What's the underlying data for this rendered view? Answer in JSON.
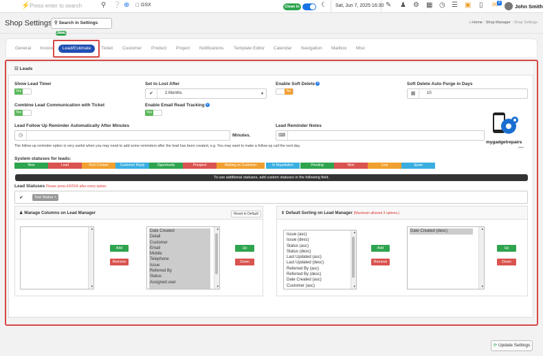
{
  "topbar": {
    "search_placeholder": "Press enter to search",
    "store": "GSX",
    "clock_in": "Clean In",
    "datetime": "Sat, Jun 7, 2025 16:30",
    "notif_count": "8",
    "user_name": "John Smith"
  },
  "header": {
    "title": "Shop Settings",
    "search_settings": "Search in Settings",
    "new_badge": "New",
    "breadcrumbs": [
      "Home",
      "Shop Manager",
      "Shop Settings"
    ]
  },
  "tabs": [
    "General",
    "Invoice",
    "Lead/Estimate",
    "Ticket",
    "Customer",
    "Product",
    "Project",
    "Notifications",
    "Template Editor",
    "Calendar",
    "Navigation",
    "Mailbox",
    "Misc"
  ],
  "active_tab": "Lead/Estimate",
  "leads": {
    "section_title": "Leads",
    "show_lead_timer": {
      "label": "Show Lead Timer",
      "value": "Yes"
    },
    "set_to_lost_after": {
      "label": "Set to Lost After",
      "value": "2 Months"
    },
    "enable_soft_delete": {
      "label": "Enable Soft Delete",
      "value": "No"
    },
    "soft_delete_purge": {
      "label": "Soft Delete Auto Purge in Days",
      "value": "10"
    },
    "combine_comm": {
      "label": "Combine Lead Communication with Ticket",
      "value": "Yes"
    },
    "email_read_tracking": {
      "label": "Enable Email Read Tracking",
      "value": "Yes"
    },
    "follow_up": {
      "label": "Lead Follow Up Reminder Automatically After Minutes",
      "unit": "Minutes."
    },
    "reminder_notes": {
      "label": "Lead Reminder Notes"
    },
    "follow_up_note": "The follow-up reminder option is very useful when you may need to add some reminders after the lead has been created, e.g. You may want to make a follow-up call the next day.",
    "system_statuses_label": "System statuses for leads:",
    "statuses": [
      {
        "label": "New",
        "color": "#2ea44f"
      },
      {
        "label": "Lead",
        "color": "#d9534f"
      },
      {
        "label": "First Contact",
        "color": "#f0a030"
      },
      {
        "label": "Customer Reply",
        "color": "#3aaee0"
      },
      {
        "label": "Opportunity",
        "color": "#2ea44f"
      },
      {
        "label": "Prospect",
        "color": "#d9534f"
      },
      {
        "label": "Waiting on Customer",
        "color": "#f0a030"
      },
      {
        "label": "In Negotiation",
        "color": "#3aaee0"
      },
      {
        "label": "Pending",
        "color": "#2ea44f"
      },
      {
        "label": "Won",
        "color": "#d9534f"
      },
      {
        "label": "Lost",
        "color": "#f0a030"
      },
      {
        "label": "Spam",
        "color": "#3aaee0"
      }
    ],
    "custom_status_bar": "To use additional statuses, add custom statuses in the following field.",
    "lead_statuses_label": "Lead Statuses",
    "lead_statuses_hint": "Please press ENTER after every option.",
    "status_tags": [
      "Test Status"
    ]
  },
  "manage_columns": {
    "title": "Manage Columns on Lead Manager",
    "reset": "Reset to Default",
    "add": "Add",
    "remove": "Remove",
    "up": "Up",
    "down": "Down",
    "selected_columns": [
      "Date Created",
      "Detail",
      "Customer",
      "Email",
      "Mobile",
      "Telephone",
      "Issue",
      "Referred By",
      "Status",
      "Assigned user"
    ]
  },
  "default_sorting": {
    "title": "Default Sorting on Lead Manager",
    "hint": "(Maximum allowed 3 options.)",
    "add": "Add",
    "remove": "Remove",
    "up": "Up",
    "down": "Down",
    "available": [
      "Issue (asc)",
      "Issue (desc)",
      "Status (asc)",
      "Status (desc)",
      "Last Updated (asc)",
      "Last Updated (desc)",
      "Referred By (asc)",
      "Referred By (desc)",
      "Date Created (asc)",
      "Customer (asc)"
    ],
    "selected": [
      "Date Created (desc)"
    ]
  },
  "logo": {
    "text": "mygadgetrepairs",
    "sub": ".com"
  },
  "update_button": "Update Settings"
}
